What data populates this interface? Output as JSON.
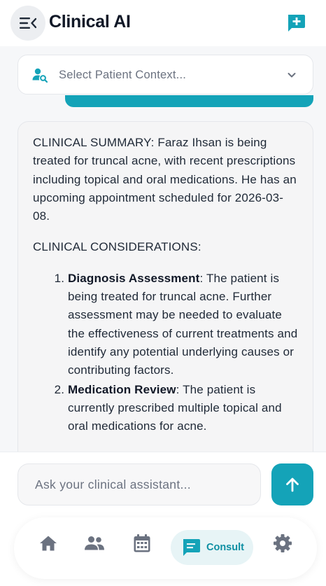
{
  "colors": {
    "accent": "#14a3b8",
    "accent_dark": "#0e8fa3",
    "icon_gray": "#6b7280"
  },
  "header": {
    "title": "Clinical AI",
    "menu_icon": "menu-collapse-icon",
    "new_chat_icon": "new-chat-icon"
  },
  "patient_select": {
    "placeholder": "Select Patient Context...",
    "icon": "person-search-icon"
  },
  "message": {
    "summary": "CLINICAL SUMMARY: Faraz Ihsan is being treated for truncal acne, with recent prescriptions including topical and oral medications. He has an upcoming appointment scheduled for 2026-03-08.",
    "considerations_heading": "CLINICAL CONSIDERATIONS:",
    "items": [
      {
        "lead": "Diagnosis Assessment",
        "text": ": The patient is being treated for truncal acne. Further assessment may be needed to evaluate the effectiveness of current treatments and identify any potential underlying causes or contributing factors."
      },
      {
        "lead": "Medication Review",
        "text": ": The patient is currently prescribed multiple topical and oral medications for acne."
      }
    ]
  },
  "composer": {
    "placeholder": "Ask your clinical assistant...",
    "send_icon": "arrow-up-icon"
  },
  "nav": {
    "items": [
      {
        "name": "home",
        "icon": "home-icon"
      },
      {
        "name": "patients",
        "icon": "people-icon"
      },
      {
        "name": "calendar",
        "icon": "calendar-icon"
      },
      {
        "name": "consult",
        "icon": "chat-icon",
        "label": "Consult",
        "active": true
      },
      {
        "name": "settings",
        "icon": "gear-icon"
      }
    ]
  }
}
